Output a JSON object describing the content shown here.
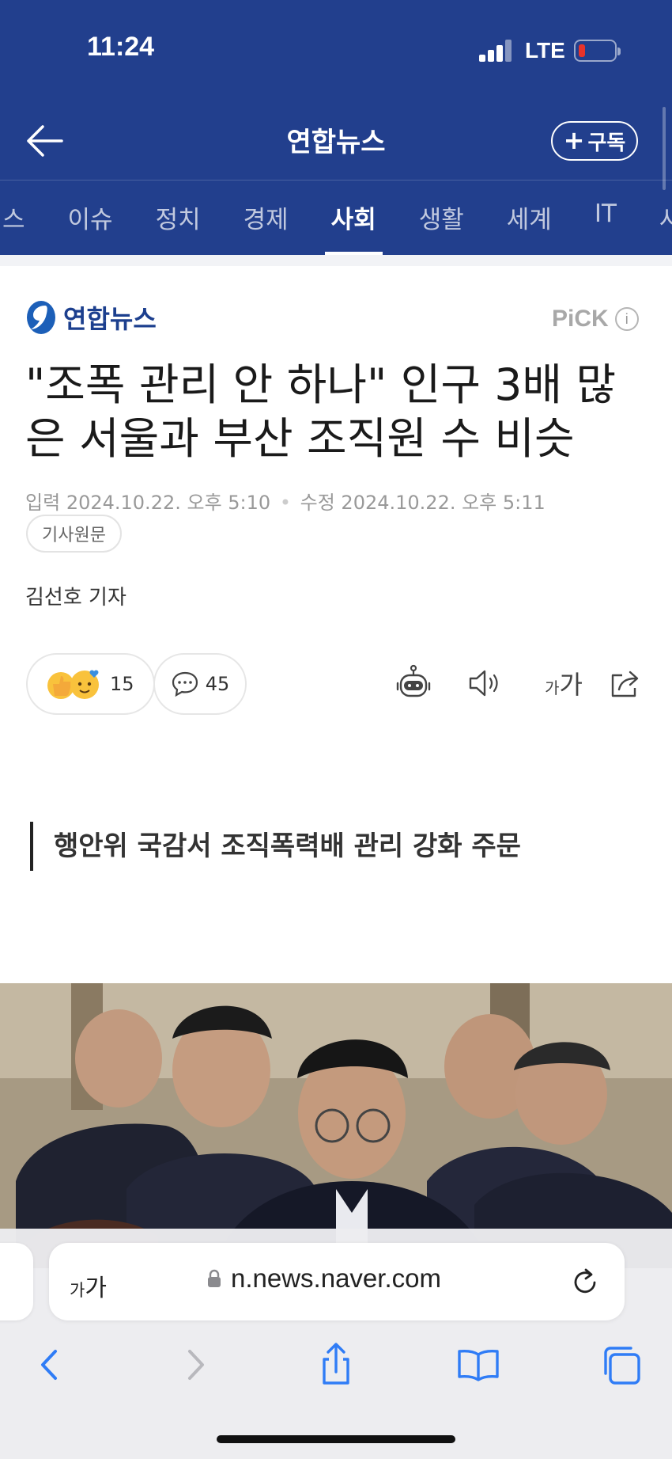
{
  "status": {
    "time": "11:24",
    "network": "LTE"
  },
  "header": {
    "title": "연합뉴스",
    "subscribe_label": "구독",
    "subscribe_icon": "plus-icon"
  },
  "tabs": [
    "스",
    "이슈",
    "정치",
    "경제",
    "사회",
    "생활",
    "세계",
    "IT",
    "사설"
  ],
  "active_tab": "사회",
  "article": {
    "press_name": "연합뉴스",
    "pick_label": "PiCK",
    "headline": "\"조폭 관리 안 하나\" 인구 3배 많은 서울과 부산 조직원 수 비슷",
    "input_label": "입력",
    "input_time": "2024.10.22. 오후 5:10",
    "modified_label": "수정",
    "modified_time": "2024.10.22. 오후 5:11",
    "original_link": "기사원문",
    "reporter": "김선호 기자",
    "reaction_count": "15",
    "comment_count": "45",
    "font_size_label": "가가",
    "subheading": "행안위 국감서 조직폭력배 관리 강화 주문"
  },
  "browser": {
    "text_size_label": "가가",
    "url": "n.news.naver.com"
  },
  "colors": {
    "header_bg": "#223f8d",
    "press_blue": "#1c3f8e",
    "ios_blue": "#2f7cf6"
  }
}
